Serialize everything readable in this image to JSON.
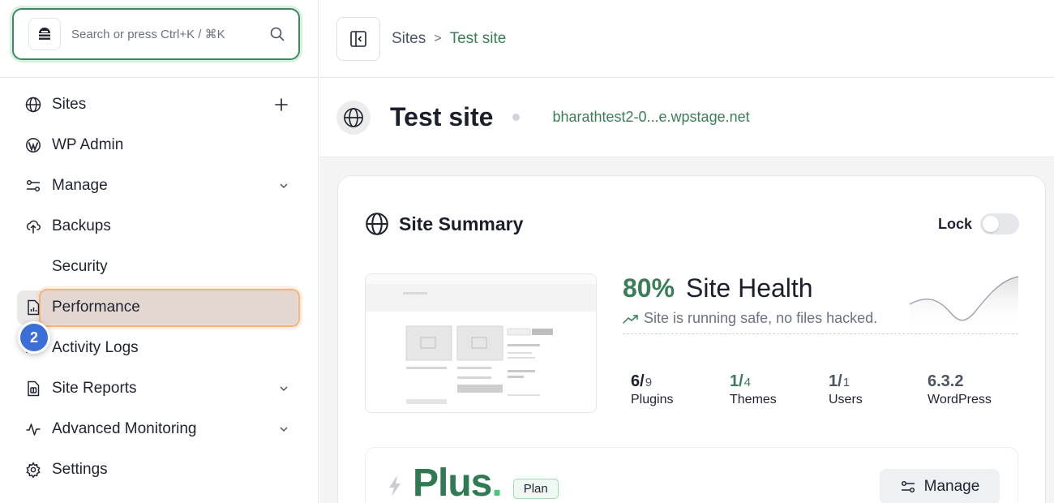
{
  "search": {
    "placeholder": "Search or press Ctrl+K / ⌘K"
  },
  "sidebar": {
    "items": [
      {
        "label": "Sites",
        "icon": "globe-icon",
        "trail": "plus-icon"
      },
      {
        "label": "WP Admin",
        "icon": "wordpress-icon"
      },
      {
        "label": "Manage",
        "icon": "sliders-icon",
        "trail": "chevron-down-icon"
      },
      {
        "label": "Backups",
        "icon": "cloud-upload-icon"
      },
      {
        "label": "Security",
        "icon": "shield-icon"
      },
      {
        "label": "Performance",
        "icon": "report-icon",
        "active": true
      },
      {
        "label": "Activity Logs",
        "icon": "list-icon"
      },
      {
        "label": "Site Reports",
        "icon": "document-icon",
        "trail": "chevron-down-icon"
      },
      {
        "label": "Advanced Monitoring",
        "icon": "pulse-icon",
        "trail": "chevron-down-icon"
      },
      {
        "label": "Settings",
        "icon": "gear-icon"
      }
    ],
    "step_badge": "2"
  },
  "breadcrumb": {
    "root": "Sites",
    "separator": ">",
    "current": "Test site"
  },
  "site": {
    "title": "Test site",
    "url": "bharathtest2-0...e.wpstage.net"
  },
  "summary": {
    "title": "Site Summary",
    "lock_label": "Lock",
    "lock_on": false,
    "health_pct": "80%",
    "health_title": "Site Health",
    "health_status": "Site is running safe, no files hacked.",
    "stats": [
      {
        "num": "6/",
        "den": "9",
        "label": "Plugins"
      },
      {
        "num": "1/",
        "den": "4",
        "label": "Themes"
      },
      {
        "num": "1/",
        "den": "1",
        "label": "Users"
      },
      {
        "num": "6.3.2",
        "den": "",
        "label": "WordPress"
      }
    ]
  },
  "plan": {
    "name": "Plus",
    "suffix": ".",
    "badge": "Plan",
    "manage_label": "Manage"
  },
  "colors": {
    "accent": "#3a7d57",
    "highlight_border": "#f4b27c",
    "badge_blue": "#3b6fd8"
  }
}
